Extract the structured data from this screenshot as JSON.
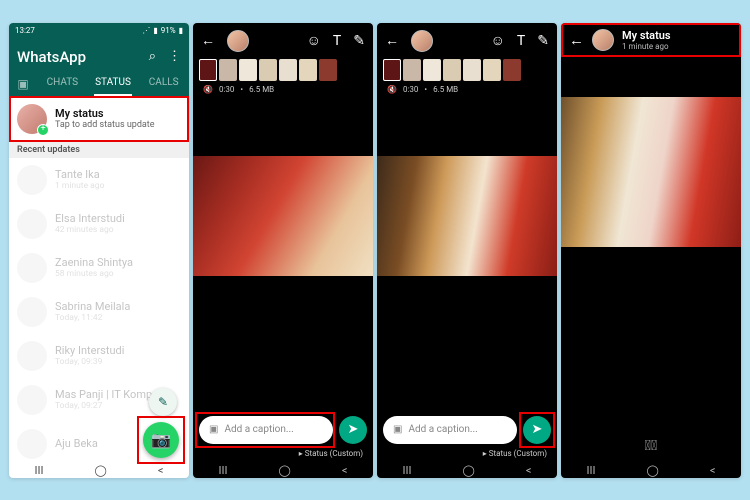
{
  "screen1": {
    "status_time": "13:27",
    "status_net": "91%",
    "app_title": "WhatsApp",
    "tabs": {
      "chats": "CHATS",
      "status": "STATUS",
      "calls": "CALLS"
    },
    "mystatus": {
      "title": "My status",
      "sub": "Tap to add status update"
    },
    "section": "Recent updates",
    "rows": [
      {
        "name": "Tante Ika",
        "time": "1 minute ago"
      },
      {
        "name": "Elsa Interstudi",
        "time": "42 minutes ago"
      },
      {
        "name": "Zaenina Shintya",
        "time": "58 minutes ago"
      },
      {
        "name": "Sabrina Meilala",
        "time": "Today, 11:42"
      },
      {
        "name": "Riky Interstudi",
        "time": "Today, 09:39"
      },
      {
        "name": "Mas Panji | IT Kompa",
        "time": "Today, 09:27"
      },
      {
        "name": "Aju Beka",
        "time": ""
      }
    ]
  },
  "editor": {
    "duration": "0:30",
    "size": "6.5 MB",
    "caption_placeholder": "Add a caption...",
    "privacy": "Status (Custom)"
  },
  "viewer": {
    "title": "My status",
    "time": "1 minute ago"
  }
}
